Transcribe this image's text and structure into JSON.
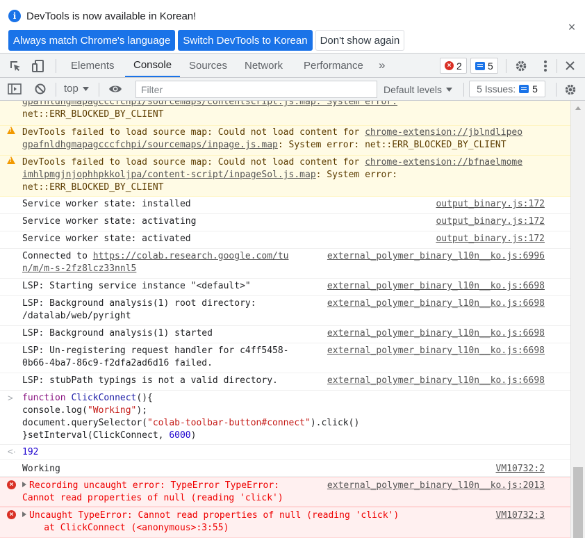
{
  "infobar": {
    "message": "DevTools is now available in Korean!",
    "buttons": {
      "always_match": "Always match Chrome's language",
      "switch": "Switch DevTools to Korean",
      "dont_show": "Don't show again"
    },
    "close": "×"
  },
  "tabs": {
    "items": [
      "Elements",
      "Console",
      "Sources",
      "Network",
      "Performance"
    ],
    "active": "Console",
    "more": "»",
    "error_count": "2",
    "message_count": "5"
  },
  "console_toolbar": {
    "context": "top",
    "filter_placeholder": "Filter",
    "levels": "Default levels",
    "issues_label": "5 Issues:",
    "issues_count": "5"
  },
  "messages": {
    "w0": {
      "line1": "gpafnldhgmapagcccfchpi/sourcemaps/contentscript.js.map: System error:",
      "line2": "net::ERR_BLOCKED_BY_CLIENT"
    },
    "w1": {
      "prefix": "DevTools failed to load source map: Could not load content for ",
      "link1": "chrome-extension://jblndlipeo",
      "link2": "gpafnldhgmapagcccfchpi/sourcemaps/inpage.js.map",
      "suffix": ": System error: net::ERR_BLOCKED_BY_CLIENT"
    },
    "w2": {
      "prefix": "DevTools failed to load source map: Could not load content for ",
      "link1": "chrome-extension://bfnaelmome",
      "link2": "imhlpmgjnjophhpkkoljpa/content-script/inpageSol.js.map",
      "suffix": ": System error:",
      "line3": "net::ERR_BLOCKED_BY_CLIENT"
    },
    "l1": {
      "text": "Service worker state: installed",
      "src": "output_binary.js:172"
    },
    "l2": {
      "text": "Service worker state: activating",
      "src": "output_binary.js:172"
    },
    "l3": {
      "text": "Service worker state: activated",
      "src": "output_binary.js:172"
    },
    "l4": {
      "prefix": "Connected to ",
      "link1": "https://colab.research.google.com/tu",
      "link2": "n/m/m-s-2fz8lcz33nnl5",
      "src": "external_polymer_binary_l10n__ko.js:6996"
    },
    "l5": {
      "text": "LSP: Starting service instance \"<default>\"",
      "src": "external_polymer_binary_l10n__ko.js:6698"
    },
    "l6": {
      "line1": "LSP: Background analysis(1) root directory:",
      "line2": "/datalab/web/pyright",
      "src": "external_polymer_binary_l10n__ko.js:6698"
    },
    "l7": {
      "text": "LSP: Background analysis(1) started",
      "src": "external_polymer_binary_l10n__ko.js:6698"
    },
    "l8": {
      "line1": "LSP: Un-registering request handler for c4ff5458-",
      "line2": "0b66-4ba7-86c9-f2dfa2ad6d16 failed.",
      "src": "external_polymer_binary_l10n__ko.js:6698"
    },
    "l9": {
      "text": "LSP: stubPath typings is not a valid directory.",
      "src": "external_polymer_binary_l10n__ko.js:6698"
    },
    "input": {
      "kw_function": "function",
      "fn_name": "ClickConnect",
      "sig_rest": "(){",
      "l2_a": "console.log(",
      "l2_str": "\"Working\"",
      "l2_b": ");",
      "l3_a": "document.querySelector(",
      "l3_str": "\"colab-toolbar-button#connect\"",
      "l3_b": ").click()",
      "l4_a": "}setInterval(ClickConnect, ",
      "l4_num": "6000",
      "l4_b": ")"
    },
    "result": "192",
    "working": {
      "text": "Working",
      "src": "VM10732:2"
    },
    "e1": {
      "line1": "Recording uncaught error: TypeError TypeError:",
      "line2": "Cannot read properties of null (reading 'click')",
      "src": "external_polymer_binary_l10n__ko.js:2013"
    },
    "e2": {
      "line1": "Uncaught TypeError: Cannot read properties of null (reading 'click')",
      "line2": "    at ClickConnect (<anonymous>:3:55)",
      "src": "VM10732:3"
    }
  },
  "icons": {
    "inspect": "inspect-element-icon",
    "device": "device-toolbar-icon",
    "settings": "gear-icon",
    "menu": "kebab-menu-icon",
    "close": "close-icon"
  },
  "colors": {
    "accent": "#1a73e8",
    "warning_bg": "#fffbe5",
    "error_bg": "#fff0f0",
    "error_text": "#e00000"
  }
}
